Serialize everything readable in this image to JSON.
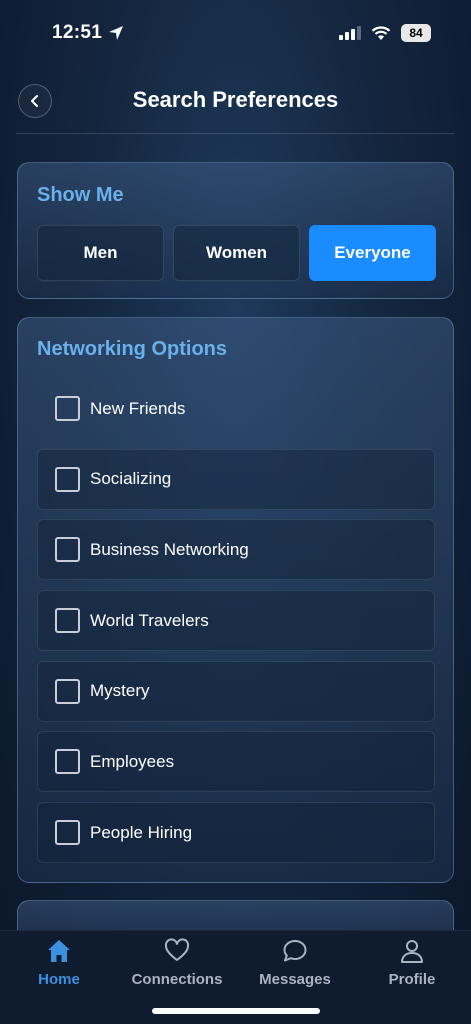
{
  "status_bar": {
    "time": "12:51",
    "battery": "84"
  },
  "header": {
    "title": "Search Preferences"
  },
  "show_me": {
    "title": "Show Me",
    "options": [
      "Men",
      "Women",
      "Everyone"
    ],
    "selected": "Everyone"
  },
  "networking": {
    "title": "Networking Options",
    "options": [
      {
        "label": "New Friends",
        "checked": false
      },
      {
        "label": "Socializing",
        "checked": false
      },
      {
        "label": "Business Networking",
        "checked": false
      },
      {
        "label": "World Travelers",
        "checked": false
      },
      {
        "label": "Mystery",
        "checked": false
      },
      {
        "label": "Employees",
        "checked": false
      },
      {
        "label": "People Hiring",
        "checked": false
      }
    ]
  },
  "tabs": [
    {
      "label": "Home",
      "icon": "home-icon",
      "active": true
    },
    {
      "label": "Connections",
      "icon": "heart-icon",
      "active": false
    },
    {
      "label": "Messages",
      "icon": "chat-bubble-icon",
      "active": false
    },
    {
      "label": "Profile",
      "icon": "person-icon",
      "active": false
    }
  ],
  "colors": {
    "accent": "#1a8cff",
    "section_title": "#6ab0ea",
    "active_tab": "#3d8fe0"
  }
}
